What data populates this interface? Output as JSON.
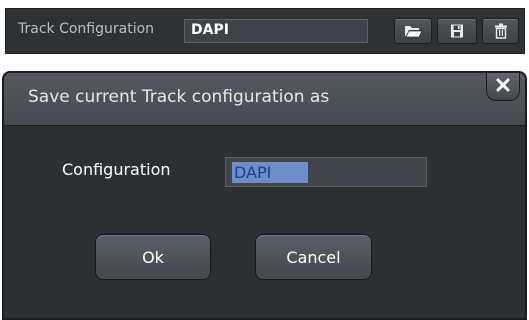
{
  "toolbar": {
    "label": "Track Configuration",
    "value": "DAPI",
    "buttons": [
      {
        "name": "open-folder-icon"
      },
      {
        "name": "save-disk-icon"
      },
      {
        "name": "trash-icon"
      }
    ]
  },
  "dialog": {
    "title": "Save current Track configuration as",
    "close_icon": "close-icon",
    "field_label": "Configuration",
    "field_value": "DAPI",
    "ok_label": "Ok",
    "cancel_label": "Cancel"
  },
  "colors": {
    "panel_bg": "#2d3033",
    "selection": "#6d8ec9",
    "selection_text": "#1b3f8a"
  }
}
